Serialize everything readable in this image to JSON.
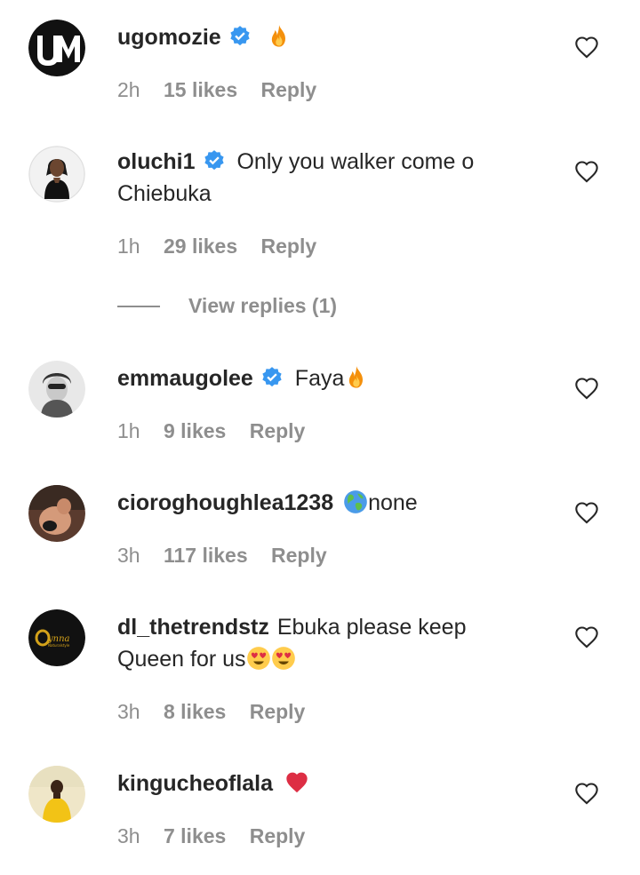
{
  "comments": [
    {
      "username": "ugomozie",
      "verified": true,
      "body_prefix": "",
      "body": "",
      "emoji_after": "fire",
      "time": "2h",
      "likes": "15 likes",
      "reply": "Reply",
      "avatar": "UM"
    },
    {
      "username": "oluchi1",
      "verified": true,
      "body": "Only you walker come o",
      "body_line2": "Chiebuka",
      "time": "1h",
      "likes": "29 likes",
      "reply": "Reply"
    },
    {
      "username": "emmaugolee",
      "verified": true,
      "body": "Faya",
      "emoji_after": "fire",
      "time": "1h",
      "likes": "9 likes",
      "reply": "Reply"
    },
    {
      "username": "cioroghoughlea1238",
      "verified": false,
      "emoji_before": "globe",
      "body": "none",
      "time": "3h",
      "likes": "117 likes",
      "reply": "Reply"
    },
    {
      "username": "dl_thetrendstz",
      "verified": false,
      "body": "Ebuka please keep",
      "body_line2": "Queen for us",
      "emoji_after": "heart-eyes heart-eyes",
      "time": "3h",
      "likes": "8 likes",
      "reply": "Reply",
      "avatar": "Dynna"
    },
    {
      "username": "kingucheoflala",
      "verified": false,
      "body": "",
      "emoji_after": "red-heart",
      "time": "3h",
      "likes": "7 likes",
      "reply": "Reply"
    }
  ],
  "view_replies": "View replies (1)",
  "colors": {
    "verified": "#3897f0",
    "secondary_text": "#8e8e8e",
    "primary_text": "#262626"
  }
}
